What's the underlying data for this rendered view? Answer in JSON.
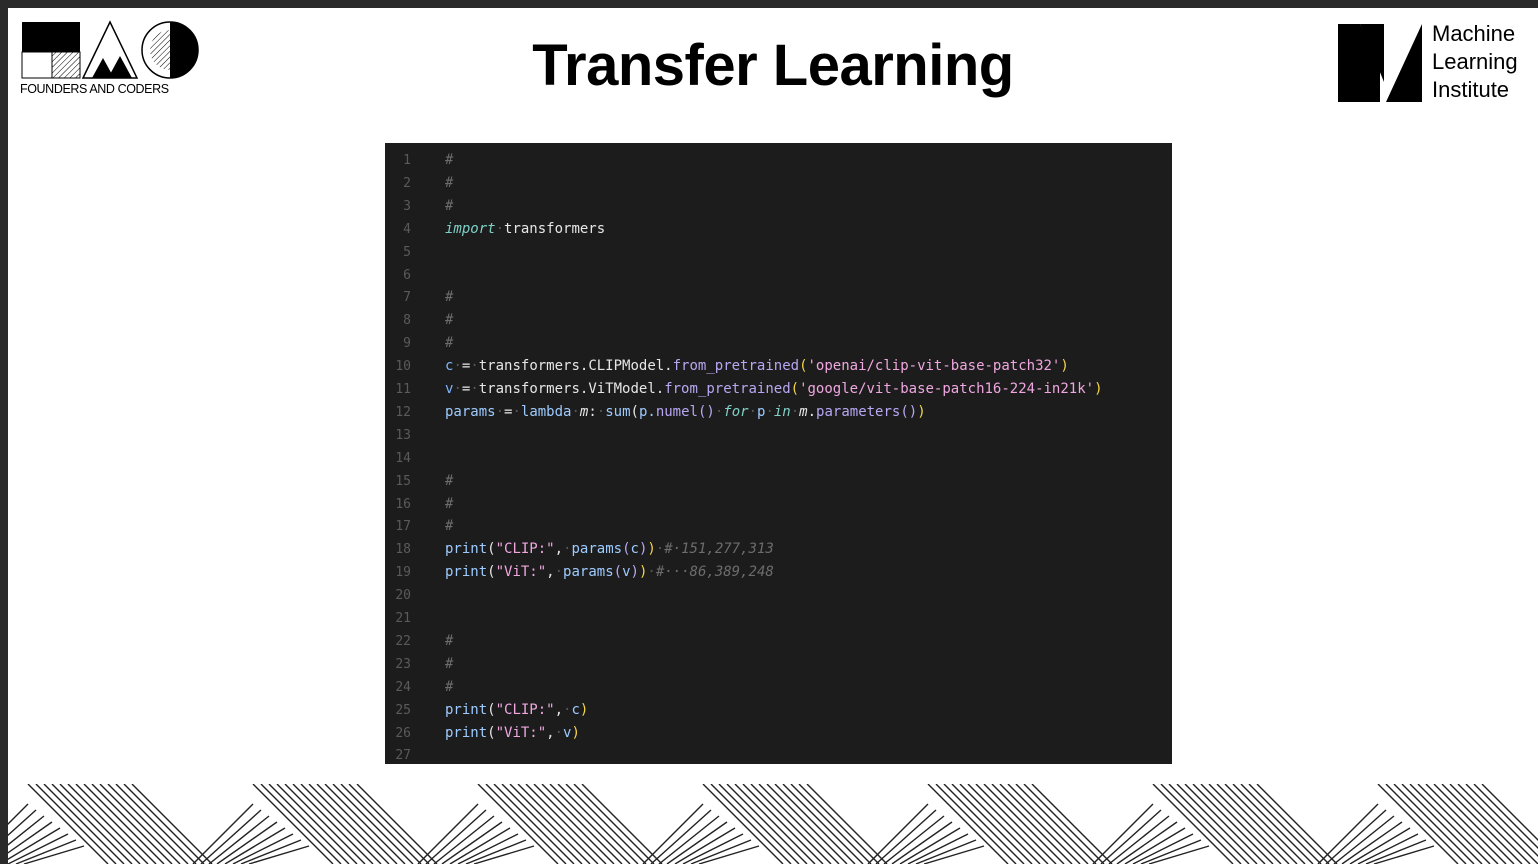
{
  "slide": {
    "title": "Transfer Learning",
    "left_logo_caption": "FOUNDERS AND CODERS",
    "right_logo_lines": [
      "Machine",
      "Learning",
      "Institute"
    ]
  },
  "code": {
    "lines": [
      {
        "n": "1",
        "tokens": [
          {
            "t": "#",
            "c": "comment"
          }
        ]
      },
      {
        "n": "2",
        "tokens": [
          {
            "t": "#",
            "c": "comment"
          }
        ]
      },
      {
        "n": "3",
        "tokens": [
          {
            "t": "#",
            "c": "comment"
          }
        ]
      },
      {
        "n": "4",
        "tokens": [
          {
            "t": "import",
            "c": "keyword"
          },
          {
            "t": "·",
            "c": "dot"
          },
          {
            "t": "transformers",
            "c": "plain"
          }
        ]
      },
      {
        "n": "5",
        "tokens": []
      },
      {
        "n": "6",
        "tokens": []
      },
      {
        "n": "7",
        "tokens": [
          {
            "t": "#",
            "c": "comment"
          }
        ]
      },
      {
        "n": "8",
        "tokens": [
          {
            "t": "#",
            "c": "comment"
          }
        ]
      },
      {
        "n": "9",
        "tokens": [
          {
            "t": "#",
            "c": "comment"
          }
        ]
      },
      {
        "n": "10",
        "tokens": [
          {
            "t": "c",
            "c": "param"
          },
          {
            "t": "·",
            "c": "dot"
          },
          {
            "t": "=",
            "c": "plain"
          },
          {
            "t": "·",
            "c": "dot"
          },
          {
            "t": "transformers.CLIPModel.",
            "c": "plain"
          },
          {
            "t": "from_pretrained",
            "c": "func"
          },
          {
            "t": "(",
            "c": "paren"
          },
          {
            "t": "'openai/clip-vit-base-patch32'",
            "c": "string"
          },
          {
            "t": ")",
            "c": "paren"
          }
        ]
      },
      {
        "n": "11",
        "tokens": [
          {
            "t": "v",
            "c": "param"
          },
          {
            "t": "·",
            "c": "dot"
          },
          {
            "t": "=",
            "c": "plain"
          },
          {
            "t": "·",
            "c": "dot"
          },
          {
            "t": "transformers.ViTModel.",
            "c": "plain"
          },
          {
            "t": "from_pretrained",
            "c": "func"
          },
          {
            "t": "(",
            "c": "paren"
          },
          {
            "t": "'google/vit-base-patch16-224-in21k'",
            "c": "string"
          },
          {
            "t": ")",
            "c": "paren"
          }
        ]
      },
      {
        "n": "12",
        "tokens": [
          {
            "t": "params",
            "c": "builtin"
          },
          {
            "t": "·",
            "c": "dot"
          },
          {
            "t": "=",
            "c": "plain"
          },
          {
            "t": "·",
            "c": "dot"
          },
          {
            "t": "lambda",
            "c": "keyword2"
          },
          {
            "t": "·",
            "c": "dot"
          },
          {
            "t": "m",
            "c": "italicplain"
          },
          {
            "t": ":",
            "c": "plain"
          },
          {
            "t": "·",
            "c": "dot"
          },
          {
            "t": "sum",
            "c": "builtin"
          },
          {
            "t": "(",
            "c": "plain"
          },
          {
            "t": "p.",
            "c": "builtin"
          },
          {
            "t": "numel",
            "c": "func"
          },
          {
            "t": "()",
            "c": "paren2"
          },
          {
            "t": "·",
            "c": "dot"
          },
          {
            "t": "for",
            "c": "keyword"
          },
          {
            "t": "·",
            "c": "dot"
          },
          {
            "t": "p",
            "c": "builtin"
          },
          {
            "t": "·",
            "c": "dot"
          },
          {
            "t": "in",
            "c": "keyword"
          },
          {
            "t": "·",
            "c": "dot"
          },
          {
            "t": "m",
            "c": "italicplain"
          },
          {
            "t": ".",
            "c": "plain"
          },
          {
            "t": "parameters",
            "c": "func"
          },
          {
            "t": "()",
            "c": "paren2"
          },
          {
            "t": ")",
            "c": "paren"
          }
        ]
      },
      {
        "n": "13",
        "tokens": []
      },
      {
        "n": "14",
        "tokens": []
      },
      {
        "n": "15",
        "tokens": [
          {
            "t": "#",
            "c": "comment"
          }
        ]
      },
      {
        "n": "16",
        "tokens": [
          {
            "t": "#",
            "c": "comment"
          }
        ]
      },
      {
        "n": "17",
        "tokens": [
          {
            "t": "#",
            "c": "comment"
          }
        ]
      },
      {
        "n": "18",
        "tokens": [
          {
            "t": "print",
            "c": "builtin"
          },
          {
            "t": "(",
            "c": "plain"
          },
          {
            "t": "\"CLIP:\"",
            "c": "string"
          },
          {
            "t": ",",
            "c": "plain"
          },
          {
            "t": "·",
            "c": "dot"
          },
          {
            "t": "params",
            "c": "builtin"
          },
          {
            "t": "(",
            "c": "paren2"
          },
          {
            "t": "c",
            "c": "builtin"
          },
          {
            "t": ")",
            "c": "paren2"
          },
          {
            "t": ")",
            "c": "paren"
          },
          {
            "t": "·",
            "c": "dot"
          },
          {
            "t": "#·151,277,313",
            "c": "comment"
          }
        ]
      },
      {
        "n": "19",
        "tokens": [
          {
            "t": "print",
            "c": "builtin"
          },
          {
            "t": "(",
            "c": "plain"
          },
          {
            "t": "\"ViT:\"",
            "c": "string"
          },
          {
            "t": ",",
            "c": "plain"
          },
          {
            "t": "·",
            "c": "dot"
          },
          {
            "t": "params",
            "c": "builtin"
          },
          {
            "t": "(",
            "c": "paren2"
          },
          {
            "t": "v",
            "c": "builtin"
          },
          {
            "t": ")",
            "c": "paren2"
          },
          {
            "t": ")",
            "c": "paren"
          },
          {
            "t": "·",
            "c": "dot"
          },
          {
            "t": "#···86,389,248",
            "c": "comment"
          }
        ]
      },
      {
        "n": "20",
        "tokens": []
      },
      {
        "n": "21",
        "tokens": []
      },
      {
        "n": "22",
        "tokens": [
          {
            "t": "#",
            "c": "comment"
          }
        ]
      },
      {
        "n": "23",
        "tokens": [
          {
            "t": "#",
            "c": "comment"
          }
        ]
      },
      {
        "n": "24",
        "tokens": [
          {
            "t": "#",
            "c": "comment"
          }
        ]
      },
      {
        "n": "25",
        "tokens": [
          {
            "t": "print",
            "c": "builtin"
          },
          {
            "t": "(",
            "c": "plain"
          },
          {
            "t": "\"CLIP:\"",
            "c": "string"
          },
          {
            "t": ",",
            "c": "plain"
          },
          {
            "t": "·",
            "c": "dot"
          },
          {
            "t": "c",
            "c": "builtin"
          },
          {
            "t": ")",
            "c": "paren"
          }
        ]
      },
      {
        "n": "26",
        "tokens": [
          {
            "t": "print",
            "c": "builtin"
          },
          {
            "t": "(",
            "c": "plain"
          },
          {
            "t": "\"ViT:\"",
            "c": "string"
          },
          {
            "t": ",",
            "c": "plain"
          },
          {
            "t": "·",
            "c": "dot"
          },
          {
            "t": "v",
            "c": "builtin"
          },
          {
            "t": ")",
            "c": "paren"
          }
        ]
      },
      {
        "n": "27",
        "tokens": []
      }
    ]
  },
  "colors": {
    "code_background": "#1c1c1c",
    "slide_background": "#ffffff",
    "frame": "#2a2a2a"
  }
}
